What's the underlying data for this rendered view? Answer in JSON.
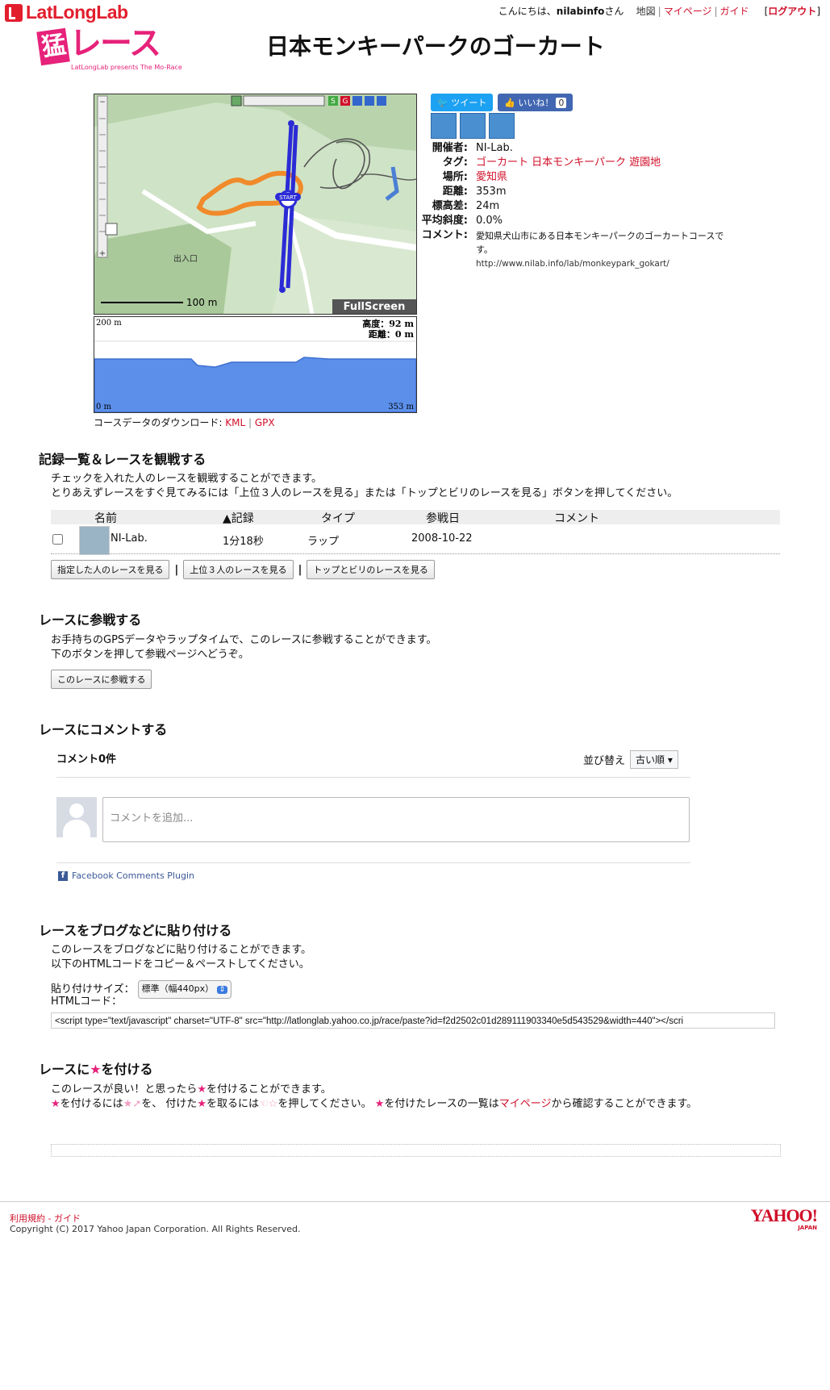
{
  "header": {
    "site_logo": "LatLongLab",
    "greeting_prefix": "こんにちは、",
    "username": "nilabinfo",
    "greeting_suffix": "さん",
    "nav": [
      "地図",
      "マイページ",
      "ガイド"
    ],
    "logout": "ログアウト",
    "logout_bracket_open": "[",
    "logout_bracket_close": "]",
    "race_logo_mo": "猛",
    "race_logo_text": "レース",
    "race_logo_sub": "LatLongLab presents The Mo-Race",
    "page_title": "日本モンキーパークのゴーカート"
  },
  "map": {
    "scale_label": "100 m",
    "fullscreen": "FullScreen",
    "start_label": "START",
    "exit_label": "出入口",
    "toolbar_s": "S",
    "toolbar_g": "G"
  },
  "profile": {
    "max_label": "200 m",
    "min_label": "0 m",
    "dist_end": "353 m",
    "altitude_label": "高度：92 m",
    "distance_label": "距離：0 m"
  },
  "download": {
    "prefix": "コースデータのダウンロード: ",
    "kml": "KML",
    "sep": " | ",
    "gpx": "GPX"
  },
  "social": {
    "tweet": "ツイート",
    "like": "いいね！",
    "like_count": "0"
  },
  "info": {
    "organizer_key": "開催者:",
    "organizer": "NI-Lab.",
    "tags_key": "タグ:",
    "tags": [
      "ゴーカート",
      "日本モンキーパーク",
      "遊園地"
    ],
    "place_key": "場所:",
    "place": "愛知県",
    "distance_key": "距離:",
    "distance": "353m",
    "elevation_key": "標高差:",
    "elevation": "24m",
    "slope_key": "平均斜度:",
    "slope": "0.0%",
    "comment_key": "コメント:",
    "comment": "愛知県犬山市にある日本モンキーパークのゴーカートコースです。",
    "url": "http://www.nilab.info/lab/monkeypark_gokart/"
  },
  "records": {
    "title": "記録一覧＆レースを観戦する",
    "desc1": "チェックを入れた人のレースを観戦することができます。",
    "desc2": "とりあえずレースをすぐ見てみるには「上位３人のレースを見る」または「トップとビリのレースを見る」ボタンを押してください。",
    "columns": [
      "名前",
      "▲記録",
      "タイプ",
      "参戦日",
      "コメント"
    ],
    "rows": [
      {
        "name": "NI-Lab.",
        "record": "1分18秒",
        "type": "ラップ",
        "date": "2008-10-22",
        "comment": ""
      }
    ],
    "btn_selected": "指定した人のレースを見る",
    "btn_top3": "上位３人のレースを見る",
    "btn_topbottom": "トップとビリのレースを見る"
  },
  "join": {
    "title": "レースに参戦する",
    "desc1": "お手持ちのGPSデータやラップタイムで、このレースに参戦することができます。",
    "desc2": "下のボタンを押して参戦ページへどうぞ。",
    "button": "このレースに参戦する"
  },
  "comment": {
    "title": "レースにコメントする",
    "count": "コメント0件",
    "sort_label": "並び替え",
    "sort_value": "古い順",
    "placeholder": "コメントを追加...",
    "plugin": "Facebook Comments Plugin"
  },
  "embed": {
    "title": "レースをブログなどに貼り付ける",
    "desc1": "このレースをブログなどに貼り付けることができます。",
    "desc2": "以下のHTMLコードをコピー＆ペーストしてください。",
    "size_label": "貼り付けサイズ：",
    "size_value": "標準（幅440px）",
    "code_label": "HTMLコード：",
    "code": "<script type=\"text/javascript\" charset=\"UTF-8\" src=\"http://latlonglab.yahoo.co.jp/race/paste?id=f2d2502c01d289111903340e5d543529&width=440\"></scri"
  },
  "star": {
    "title_pre": "レースに",
    "title_post": "を付ける",
    "desc1_pre": "このレースが良い！と思ったら",
    "desc1_post": "を付けることができます。",
    "desc2_a": "を付けるには",
    "desc2_b": "を、 付けた",
    "desc2_c": "を取るには",
    "desc2_d": "を押してください。",
    "desc2_e": "を付けたレースの一覧は",
    "mypage": "マイページ",
    "desc2_f": "から確認することができます。"
  },
  "footer": {
    "terms": "利用規約",
    "sep": " - ",
    "guide": "ガイド",
    "copyright": "Copyright (C) 2017 Yahoo Japan Corporation. All Rights Reserved.",
    "yahoo": "YAHOO!",
    "yahoo_sub": "JAPAN"
  },
  "colors": {
    "accent": "#d0102a",
    "brand_pink": "#e6227a",
    "route_blue": "#2b2bd6",
    "course_orange": "#f08a2a"
  }
}
